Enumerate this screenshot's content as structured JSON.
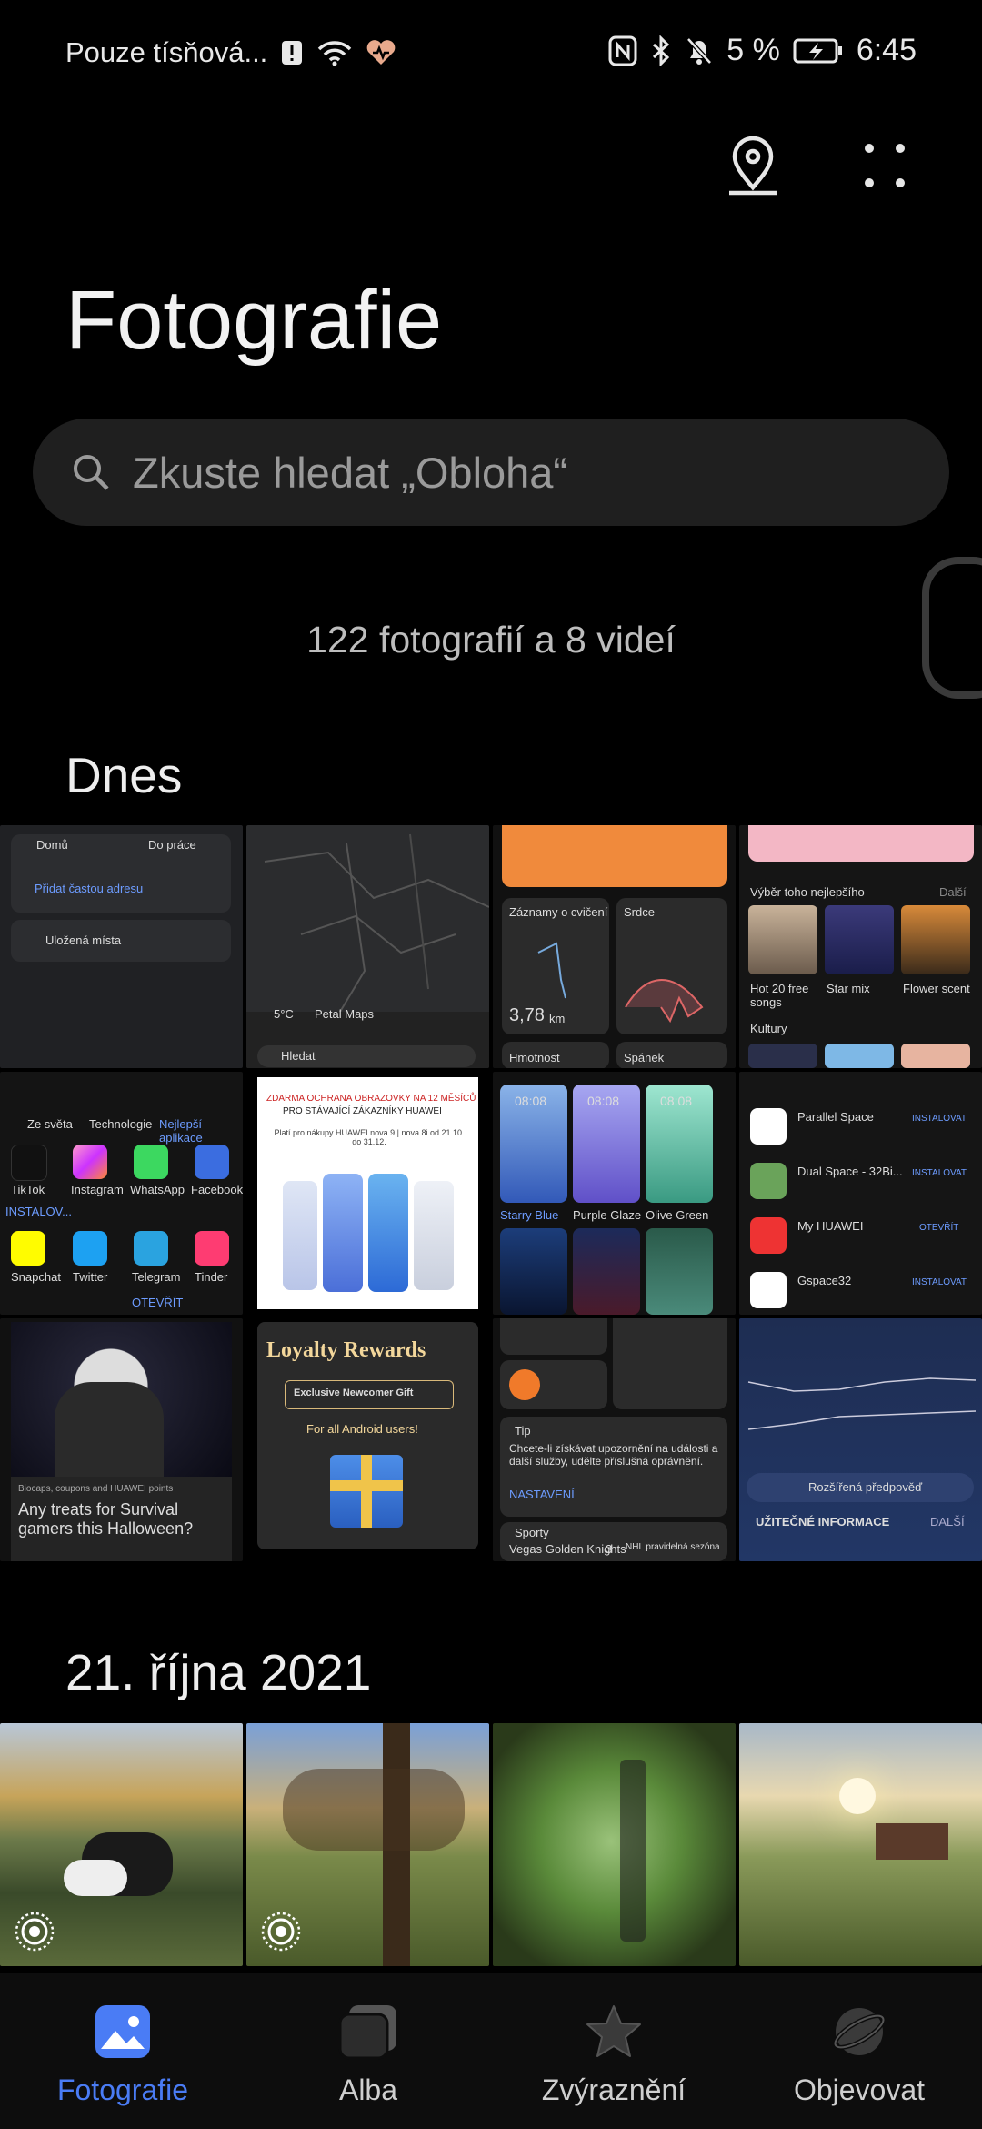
{
  "status_bar": {
    "carrier": "Pouze tísňová...",
    "battery_percent": "5 %",
    "time": "6:45"
  },
  "header": {
    "title": "Fotografie",
    "map_icon": "location-pin-icon",
    "menu_icon": "more-dots-icon"
  },
  "search": {
    "placeholder": "Zkuste hledat „Obloha“"
  },
  "summary": "122 fotografií a 8 videí",
  "sections": [
    {
      "title": "Dnes"
    },
    {
      "title": "21. října 2021"
    }
  ],
  "screenshots": {
    "s1": {
      "home": "Domů",
      "work": "Do práce",
      "add": "Přidat častou adresu",
      "saved": "Uložená místa"
    },
    "s2": {
      "temp": "5°C",
      "maps": "Petal Maps",
      "search": "Hledat"
    },
    "s3": {
      "exercise": "Záznamy o cvičení",
      "heart": "Srdce",
      "distance": "3,78",
      "unit": "km",
      "weight": "Hmotnost",
      "sleep": "Spánek"
    },
    "s4": {
      "header": "Výběr toho nejlepšího",
      "more": "Další",
      "items": [
        "Hot 20 free songs",
        "Star mix",
        "Flower scent"
      ],
      "culture": "Kultury"
    },
    "s5": {
      "tabs": [
        "Ze světa",
        "Technologie",
        "Nejlepší aplikace"
      ],
      "apps_row1": [
        "TikTok",
        "Instagram",
        "WhatsApp",
        "Facebook"
      ],
      "apps_row2": [
        "Snapchat",
        "Twitter",
        "Telegram",
        "Tinder"
      ],
      "install": "INSTALOV...",
      "open": "OTEVŘÍT"
    },
    "s6": {
      "promo": "ZDARMA OCHRANA OBRAZOVKY NA 12 MĚSÍCŮ",
      "promo2": "PRO STÁVAJÍCÍ ZÁKAZNÍKY HUAWEI",
      "small": "Platí pro nákupy HUAWEI nova 9 | nova 8i od 21.10. do 31.12."
    },
    "s7": {
      "time": "08:08",
      "themes": [
        "Starry Blue",
        "Purple Glaze",
        "Olive Green"
      ]
    },
    "s8": {
      "apps": [
        "Parallel Space",
        "Dual Space - 32Bi...",
        "My HUAWEI",
        "Gspace32"
      ],
      "install": "INSTALOVAT",
      "open": "OTEVŘÍT"
    },
    "s9": {
      "caption_small": "Biocaps, coupons and HUAWEI points",
      "caption": "Any treats for Survival gamers this Halloween?"
    },
    "s10": {
      "title": "Loyalty Rewards",
      "button": "Exclusive Newcomer Gift",
      "sub": "For all Android users!"
    },
    "s11": {
      "tip": "Tip",
      "tip_text": "Chcete-li získávat upozornění na události a další služby, udělte příslušná oprávnění.",
      "settings": "NASTAVENÍ",
      "sports": "Sporty",
      "team": "Vegas Golden Knights",
      "score": "3",
      "league": "NHL pravidelná sezóna"
    },
    "s12": {
      "forecast": "Rozšířená předpověď",
      "info": "UŽITEČNÉ INFORMACE",
      "more": "DALŠÍ"
    }
  },
  "nav": [
    {
      "label": "Fotografie",
      "icon": "photos-icon",
      "active": true
    },
    {
      "label": "Alba",
      "icon": "albums-icon",
      "active": false
    },
    {
      "label": "Zvýraznění",
      "icon": "highlights-star-icon",
      "active": false
    },
    {
      "label": "Objevovat",
      "icon": "discover-planet-icon",
      "active": false
    }
  ],
  "colors": {
    "accent": "#4a7cf5",
    "inactive": "#cfcfcf"
  }
}
